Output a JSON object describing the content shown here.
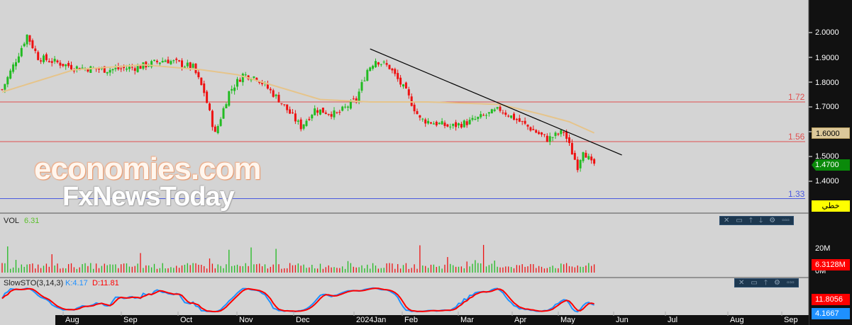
{
  "chart_data": {
    "type": "candlestick",
    "price_axis": {
      "ticks": [
        "2.0000",
        "1.9000",
        "1.8000",
        "1.7000",
        "1.6000",
        "1.5000",
        "1.4000"
      ],
      "range": [
        1.31,
        2.13
      ]
    },
    "close_anchors": [
      [
        0,
        1.77
      ],
      [
        5,
        1.89
      ],
      [
        9,
        1.99
      ],
      [
        13,
        1.9
      ],
      [
        26,
        1.86
      ],
      [
        38,
        1.85
      ],
      [
        49,
        1.86
      ],
      [
        59,
        1.89
      ],
      [
        69,
        1.86
      ],
      [
        73,
        1.76
      ],
      [
        77,
        1.59
      ],
      [
        82,
        1.76
      ],
      [
        87,
        1.83
      ],
      [
        92,
        1.82
      ],
      [
        100,
        1.73
      ],
      [
        108,
        1.62
      ],
      [
        113,
        1.69
      ],
      [
        121,
        1.67
      ],
      [
        128,
        1.73
      ],
      [
        132,
        1.85
      ],
      [
        135,
        1.89
      ],
      [
        140,
        1.86
      ],
      [
        146,
        1.76
      ],
      [
        151,
        1.65
      ],
      [
        162,
        1.62
      ],
      [
        169,
        1.64
      ],
      [
        180,
        1.69
      ],
      [
        190,
        1.62
      ],
      [
        197,
        1.57
      ],
      [
        203,
        1.6
      ],
      [
        208,
        1.46
      ],
      [
        210,
        1.53
      ],
      [
        213,
        1.47
      ]
    ],
    "ma_anchors": [
      [
        0,
        1.76
      ],
      [
        26,
        1.85
      ],
      [
        51,
        1.87
      ],
      [
        72,
        1.85
      ],
      [
        85,
        1.83
      ],
      [
        103,
        1.77
      ],
      [
        115,
        1.73
      ],
      [
        133,
        1.72
      ],
      [
        154,
        1.72
      ],
      [
        180,
        1.71
      ],
      [
        195,
        1.67
      ],
      [
        205,
        1.64
      ],
      [
        214,
        1.595
      ]
    ],
    "trendline": [
      [
        133,
        1.934
      ],
      [
        224,
        1.506
      ]
    ],
    "hlines": [
      {
        "label": "1.72",
        "value": 1.72,
        "color": "#e05050"
      },
      {
        "label": "1.56",
        "value": 1.56,
        "color": "#e05050"
      },
      {
        "label": "1.33",
        "value": 1.33,
        "color": "#4a5ae0"
      }
    ],
    "months": [
      "Aug",
      "Sep",
      "Oct",
      "Nov",
      "Dec",
      "2024Jan",
      "Feb",
      "Mar",
      "Apr",
      "May",
      "Jun",
      "Jul",
      "Aug",
      "Sep"
    ],
    "volume": {
      "title": "VOL",
      "value": "6.31",
      "ticks": [
        "20M",
        "0M"
      ],
      "last": "6.3128M"
    },
    "stoch": {
      "title": "SlowSTO(3,14,3)",
      "k_label": "K:4.17",
      "d_label": "D:11.81",
      "d_last": "11.8056",
      "k_last": "4.1667"
    }
  },
  "tags": {
    "ma_value": "1.6000",
    "last_price": "1.4700",
    "linear": "خطي"
  },
  "watermark": {
    "line1": "economies.com",
    "line2": "FxNewsToday"
  },
  "toolbar": [
    "✕",
    "▭",
    "🡑",
    "🡓",
    "⚙",
    "▫▫▫"
  ],
  "toolbar2": [
    "✕",
    "▭",
    "🡑",
    "⚙",
    "▫▫▫"
  ]
}
